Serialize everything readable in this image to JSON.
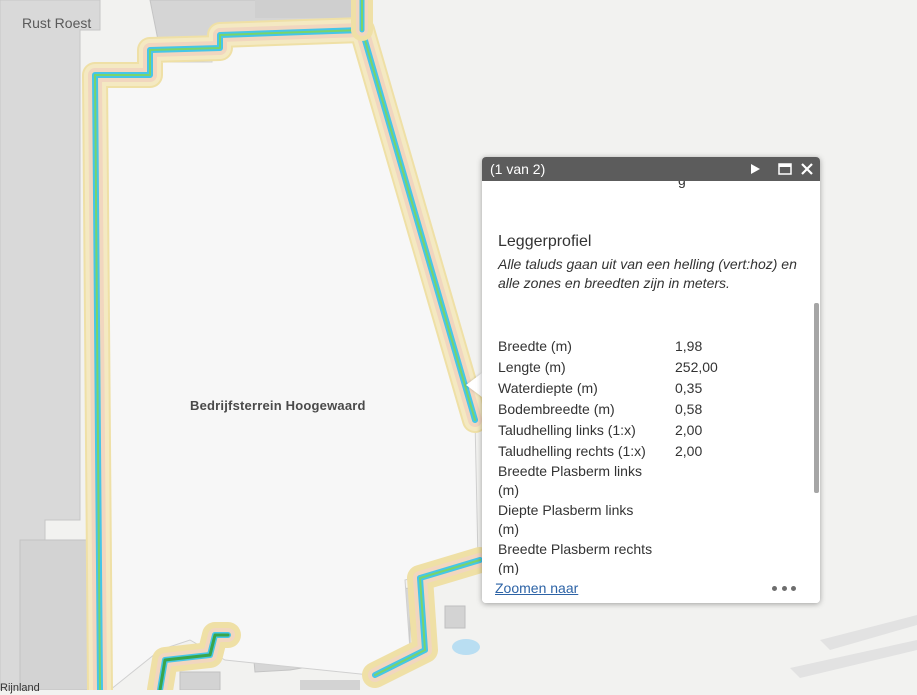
{
  "map": {
    "labels": {
      "rust_roest": "Rust Roest",
      "terrein": "Bedrijfsterrein Hoogewaard",
      "bottom_left": "Rijnland"
    },
    "colors": {
      "background": "#f2f2f0",
      "building": "#d7d7d7",
      "buffer_outer": "#f3e7b6",
      "buffer_inner": "#f1d6bf",
      "waterway": "#45c6e8",
      "centerline": "#3aa54a"
    }
  },
  "popup": {
    "title": "(1 van 2)",
    "icons": {
      "next": "play-next-icon",
      "maximize": "maximize-icon",
      "close": "close-icon",
      "more": "more-icon"
    },
    "cut_text": "g",
    "section_title": "Leggerprofiel",
    "section_description": "Alle taluds gaan uit van een helling (vert:hoz) en alle zones en breedten zijn in meters.",
    "attributes": [
      {
        "name": "Breedte (m)",
        "value": "1,98"
      },
      {
        "name": "Lengte (m)",
        "value": "252,00"
      },
      {
        "name": "Waterdiepte (m)",
        "value": "0,35"
      },
      {
        "name": "Bodembreedte (m)",
        "value": "0,58"
      },
      {
        "name": "Taludhelling links (1:x)",
        "value": "2,00"
      },
      {
        "name": "Taludhelling rechts (1:x)",
        "value": "2,00"
      },
      {
        "name": "Breedte Plasberm links (m)",
        "value": ""
      },
      {
        "name": "Diepte Plasberm links (m)",
        "value": ""
      },
      {
        "name": "Breedte Plasberm rechts (m)",
        "value": ""
      }
    ],
    "zoom_link": "Zoomen naar"
  }
}
